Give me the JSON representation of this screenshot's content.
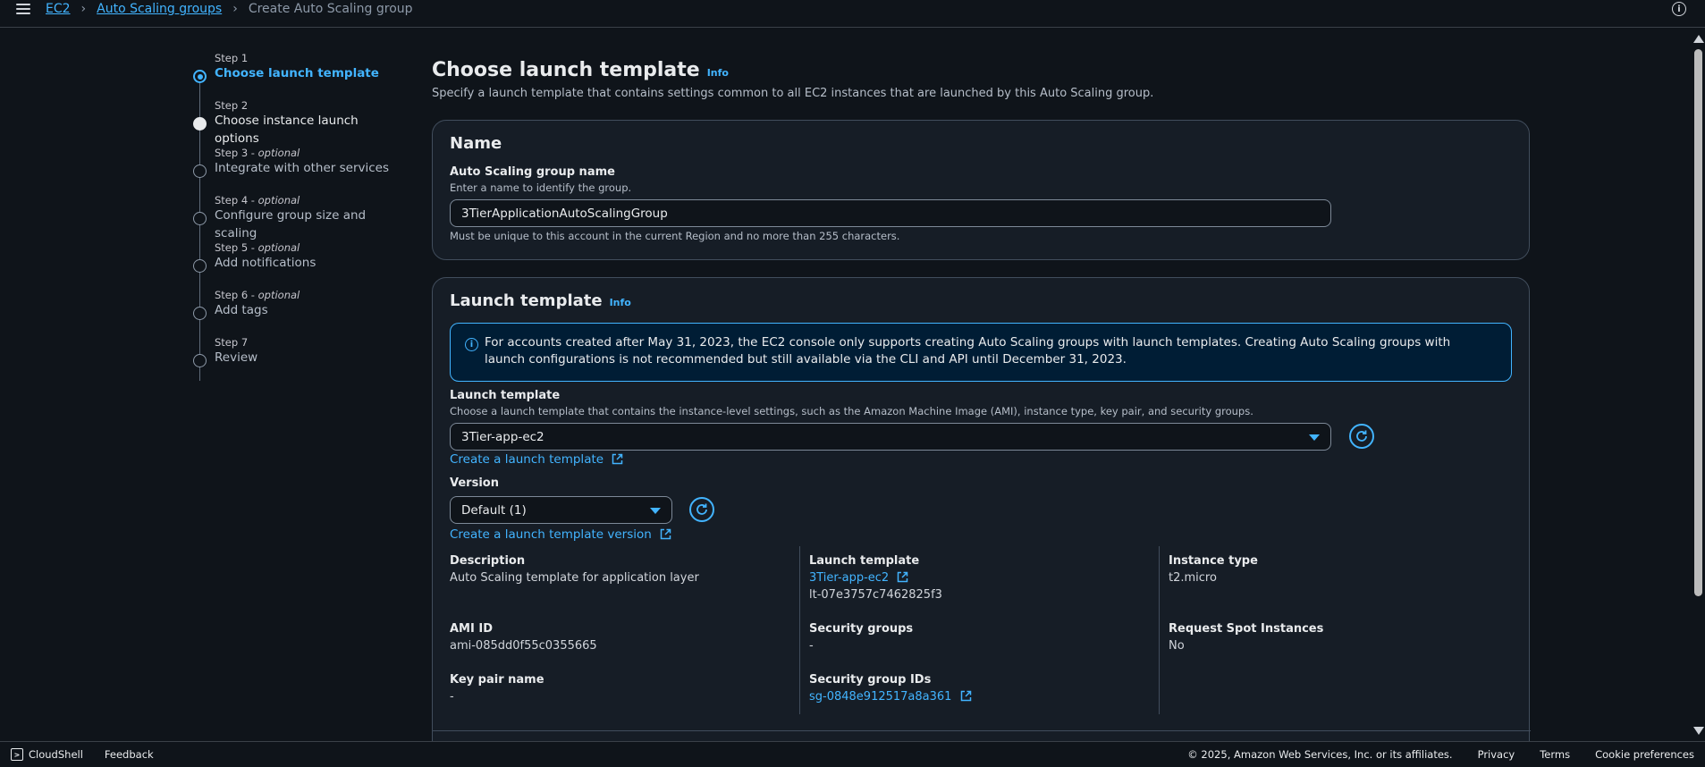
{
  "breadcrumb": {
    "items": [
      "EC2",
      "Auto Scaling groups"
    ],
    "current": "Create Auto Scaling group"
  },
  "steps": [
    {
      "num": "Step 1",
      "optional": "",
      "title": "Choose launch template"
    },
    {
      "num": "Step 2",
      "optional": "",
      "title": "Choose instance launch options"
    },
    {
      "num": "Step 3 - ",
      "optional": "optional",
      "title": "Integrate with other services"
    },
    {
      "num": "Step 4 - ",
      "optional": "optional",
      "title": "Configure group size and scaling"
    },
    {
      "num": "Step 5 - ",
      "optional": "optional",
      "title": "Add notifications"
    },
    {
      "num": "Step 6 - ",
      "optional": "optional",
      "title": "Add tags"
    },
    {
      "num": "Step 7",
      "optional": "",
      "title": "Review"
    }
  ],
  "page": {
    "title": "Choose launch template",
    "info": "Info",
    "subtitle": "Specify a launch template that contains settings common to all EC2 instances that are launched by this Auto Scaling group."
  },
  "name_card": {
    "title": "Name",
    "label": "Auto Scaling group name",
    "desc": "Enter a name to identify the group.",
    "value": "3TierApplicationAutoScalingGroup",
    "constraint": "Must be unique to this account in the current Region and no more than 255 characters."
  },
  "launch_card": {
    "title": "Launch template",
    "info": "Info",
    "alert": "For accounts created after May 31, 2023, the EC2 console only supports creating Auto Scaling groups with launch templates. Creating Auto Scaling groups with launch configurations is not recommended but still available via the CLI and API until December 31, 2023.",
    "lt_label": "Launch template",
    "lt_desc": "Choose a launch template that contains the instance-level settings, such as the Amazon Machine Image (AMI), instance type, key pair, and security groups.",
    "lt_value": "3Tier-app-ec2",
    "create_lt": "Create a launch template",
    "version_label": "Version",
    "version_value": "Default (1)",
    "create_version": "Create a launch template version"
  },
  "details": {
    "description": {
      "k": "Description",
      "v": "Auto Scaling template for application layer"
    },
    "launch_template": {
      "k": "Launch template",
      "link": "3Tier-app-ec2",
      "id": "lt-07e3757c7462825f3"
    },
    "instance_type": {
      "k": "Instance type",
      "v": "t2.micro"
    },
    "ami_id": {
      "k": "AMI ID",
      "v": "ami-085dd0f55c0355665"
    },
    "security_groups": {
      "k": "Security groups",
      "v": "-"
    },
    "spot": {
      "k": "Request Spot Instances",
      "v": "No"
    },
    "key_pair": {
      "k": "Key pair name",
      "v": "-"
    },
    "sg_ids": {
      "k": "Security group IDs",
      "link": "sg-0848e912517a8a361"
    }
  },
  "footer": {
    "cloudshell": "CloudShell",
    "feedback": "Feedback",
    "copyright": "© 2025, Amazon Web Services, Inc. or its affiliates.",
    "privacy": "Privacy",
    "terms": "Terms",
    "cookies": "Cookie preferences"
  },
  "colors": {
    "accent": "#42b4ff",
    "background": "#0f141a",
    "card": "#161d26"
  }
}
